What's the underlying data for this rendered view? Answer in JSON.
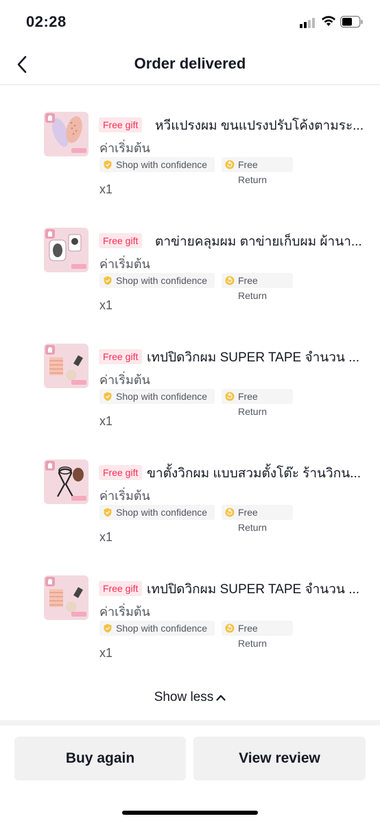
{
  "status_bar": {
    "time": "02:28"
  },
  "nav": {
    "title": "Order delivered"
  },
  "items": [
    {
      "tag": "Free gift",
      "title": "หวีแปรงผม ขนแปรงปรับโค้งตามระ...",
      "variant": "ค่าเริ่มต้น",
      "badge_confidence": "Shop with confidence",
      "badge_return": "Free Return",
      "qty": "x1"
    },
    {
      "tag": "Free gift",
      "title": "ตาข่ายคลุมผม ตาข่ายเก็บผม ผ้านา...",
      "variant": "ค่าเริ่มต้น",
      "badge_confidence": "Shop with confidence",
      "badge_return": "Free Return",
      "qty": "x1"
    },
    {
      "tag": "Free gift",
      "title": "เทปปิดวิกผม SUPER TAPE จำนวน ...",
      "variant": "ค่าเริ่มต้น",
      "badge_confidence": "Shop with confidence",
      "badge_return": "Free Return",
      "qty": "x1"
    },
    {
      "tag": "Free gift",
      "title": "ขาตั้งวิกผม แบบสวมตั้งโต๊ะ ร้านวิกน...",
      "variant": "ค่าเริ่มต้น",
      "badge_confidence": "Shop with confidence",
      "badge_return": "Free Return",
      "qty": "x1"
    },
    {
      "tag": "Free gift",
      "title": "เทปปิดวิกผม SUPER TAPE จำนวน ...",
      "variant": "ค่าเริ่มต้น",
      "badge_confidence": "Shop with confidence",
      "badge_return": "Free Return",
      "qty": "x1"
    }
  ],
  "show_less": "Show less",
  "actions": {
    "buy_again": "Buy again",
    "view_review": "View review"
  },
  "colors": {
    "gift_red": "#fe2c55",
    "gift_bg": "#fde8ec",
    "shield_gold": "#f5c242",
    "chip_bg": "#f5f5f6"
  }
}
